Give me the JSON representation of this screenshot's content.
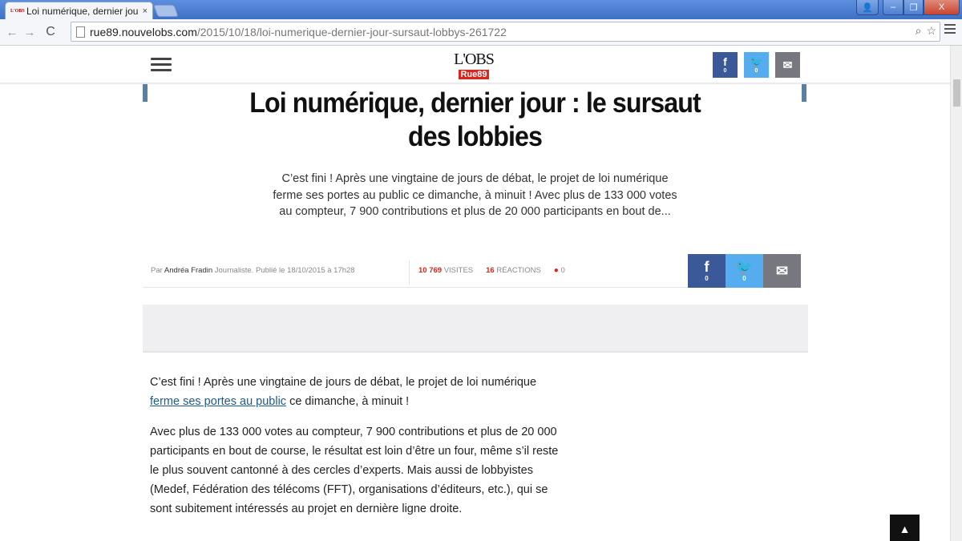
{
  "browser": {
    "tab_title": "Loi numérique, dernier jou",
    "tab_favicon": "L'OBS",
    "tab_close": "×",
    "url_host": "rue89.nouvelobs.com",
    "url_path": "/2015/10/18/loi-numerique-dernier-jour-sursaut-lobbys-261722",
    "back_icon": "←",
    "forward_icon": "→",
    "reload_icon": "C",
    "search_icon": "⌕",
    "star_icon": "☆",
    "window": {
      "minimize": "–",
      "maximize": "❐",
      "close": "X",
      "user": "👤"
    }
  },
  "header": {
    "logo_top": "L'OBS",
    "logo_bottom": "Rue89",
    "share": [
      {
        "label": "f",
        "count": "0",
        "color": "#3b5998"
      },
      {
        "label": "🐦",
        "count": "0",
        "color": "#55acee"
      },
      {
        "label": "✉",
        "count": "",
        "color": "#777780"
      }
    ]
  },
  "article": {
    "title": "Loi numérique, dernier jour : le sursaut des lobbies",
    "lead": "C’est fini ! Après une vingtaine de jours de débat, le projet de loi numérique ferme ses portes au public ce dimanche, à minuit ! Avec plus de 133 000 votes au compteur, 7 900 contributions et plus de 20 000 participants en bout de...",
    "byline_prefix": "Par",
    "author": "Andréa Fradin",
    "byline_suffix": "Journaliste. Publié le 18/10/2015 à 17h28",
    "visits_count": "10 769",
    "visits_label": "VISITES",
    "reactions_count": "16",
    "reactions_label": "RÉACTIONS",
    "live_dot": "●",
    "live_count": "0",
    "share": [
      {
        "label": "f",
        "count": "0",
        "color": "#3b5998"
      },
      {
        "label": "🐦",
        "count": "0",
        "color": "#55acee"
      },
      {
        "label": "✉",
        "count": "",
        "color": "#777780"
      }
    ],
    "p1_before_link": "C’est fini ! Après une vingtaine de jours de débat, le projet de loi numérique ",
    "p1_link": "ferme ses portes au public",
    "p1_after_link": " ce dimanche, à minuit !",
    "p2": "Avec plus de 133 000 votes au compteur, 7 900 contributions et plus de 20 000 participants en bout de course, le résultat est loin d’être un four, même s’il reste le plus souvent cantonné à des cercles d’experts. Mais aussi de lobbyistes (Medef, Fédération des télécoms (FFT), organisations d’éditeurs, etc.), qui se sont subitement intéressés au projet en dernière ligne droite."
  },
  "to_top_icon": "▲"
}
